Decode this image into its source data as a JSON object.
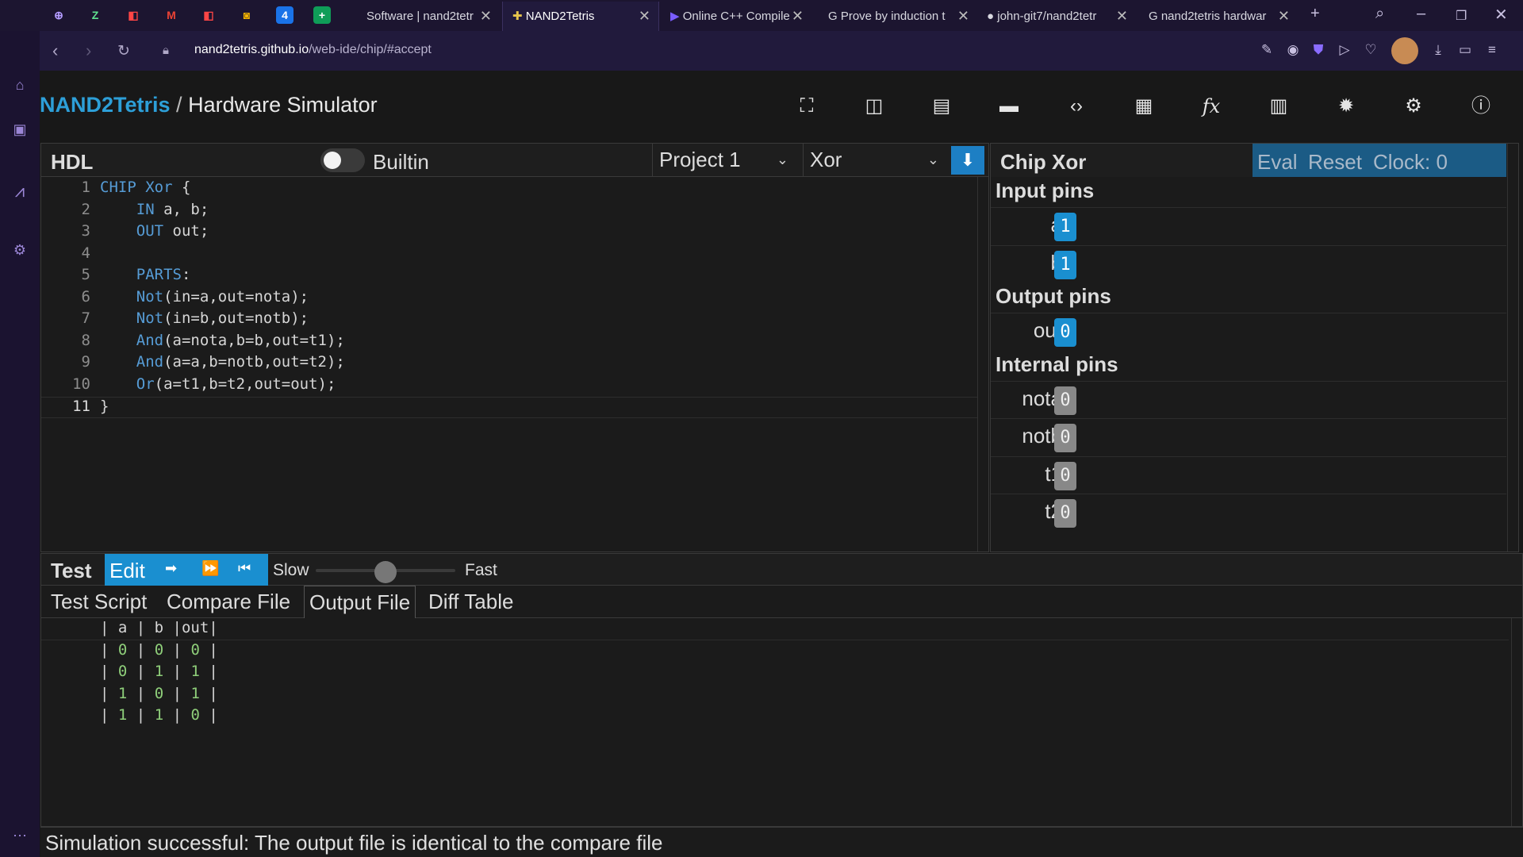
{
  "browser": {
    "tabs": [
      {
        "label": "Software | nand2tetr"
      },
      {
        "label": "NAND2Tetris"
      },
      {
        "label": "Online C++ Compile"
      },
      {
        "label": "Prove by induction t"
      },
      {
        "label": "john-git7/nand2tetr"
      },
      {
        "label": "nand2tetris hardwar"
      }
    ],
    "url_domain": "nand2tetris.github.io",
    "url_path": "/web-ide/chip/#accept"
  },
  "app": {
    "brand": "NAND2Tetris",
    "separator": "/",
    "title": "Hardware Simulator"
  },
  "hdl": {
    "title": "HDL",
    "builtin_label": "Builtin",
    "builtin_on": false,
    "project_select": "Project 1",
    "chip_select": "Xor",
    "lines": [
      {
        "n": "1",
        "kw": "CHIP Xor",
        "rest": " {"
      },
      {
        "n": "2",
        "kw": "    IN",
        "rest": " a, b;"
      },
      {
        "n": "3",
        "kw": "    OUT",
        "rest": " out;"
      },
      {
        "n": "4",
        "kw": "",
        "rest": ""
      },
      {
        "n": "5",
        "kw": "    PARTS",
        "rest": ":"
      },
      {
        "n": "6",
        "kw": "    Not",
        "rest": "(in=a,out=nota);"
      },
      {
        "n": "7",
        "kw": "    Not",
        "rest": "(in=b,out=notb);"
      },
      {
        "n": "8",
        "kw": "    And",
        "rest": "(a=nota,b=b,out=t1);"
      },
      {
        "n": "9",
        "kw": "    And",
        "rest": "(a=a,b=notb,out=t2);"
      },
      {
        "n": "10",
        "kw": "    Or",
        "rest": "(a=t1,b=t2,out=out);"
      },
      {
        "n": "11",
        "kw": "",
        "rest": "}"
      }
    ]
  },
  "chip": {
    "title": "Chip Xor",
    "eval_label": "Eval",
    "reset_label": "Reset",
    "clock_label": "Clock: 0",
    "input_title": "Input pins",
    "output_title": "Output pins",
    "internal_title": "Internal pins",
    "inputs": [
      {
        "name": "a",
        "value": "1"
      },
      {
        "name": "b",
        "value": "1"
      }
    ],
    "outputs": [
      {
        "name": "out",
        "value": "0"
      }
    ],
    "internals": [
      {
        "name": "nota",
        "value": "0"
      },
      {
        "name": "notb",
        "value": "0"
      },
      {
        "name": "t1",
        "value": "0"
      },
      {
        "name": "t2",
        "value": "0"
      }
    ]
  },
  "test": {
    "title": "Test",
    "edit_label": "Edit",
    "slow_label": "Slow",
    "fast_label": "Fast",
    "speed_fraction": 0.5,
    "tabs": [
      "Test Script",
      "Compare File",
      "Output File",
      "Diff Table"
    ],
    "active_tab": "Output File",
    "table_header": "| a | b |out|",
    "rows": [
      [
        "0",
        "0",
        "0"
      ],
      [
        "0",
        "1",
        "1"
      ],
      [
        "1",
        "0",
        "1"
      ],
      [
        "1",
        "1",
        "0"
      ]
    ]
  },
  "status": {
    "text": "Simulation successful: The output file is identical to the compare file"
  }
}
